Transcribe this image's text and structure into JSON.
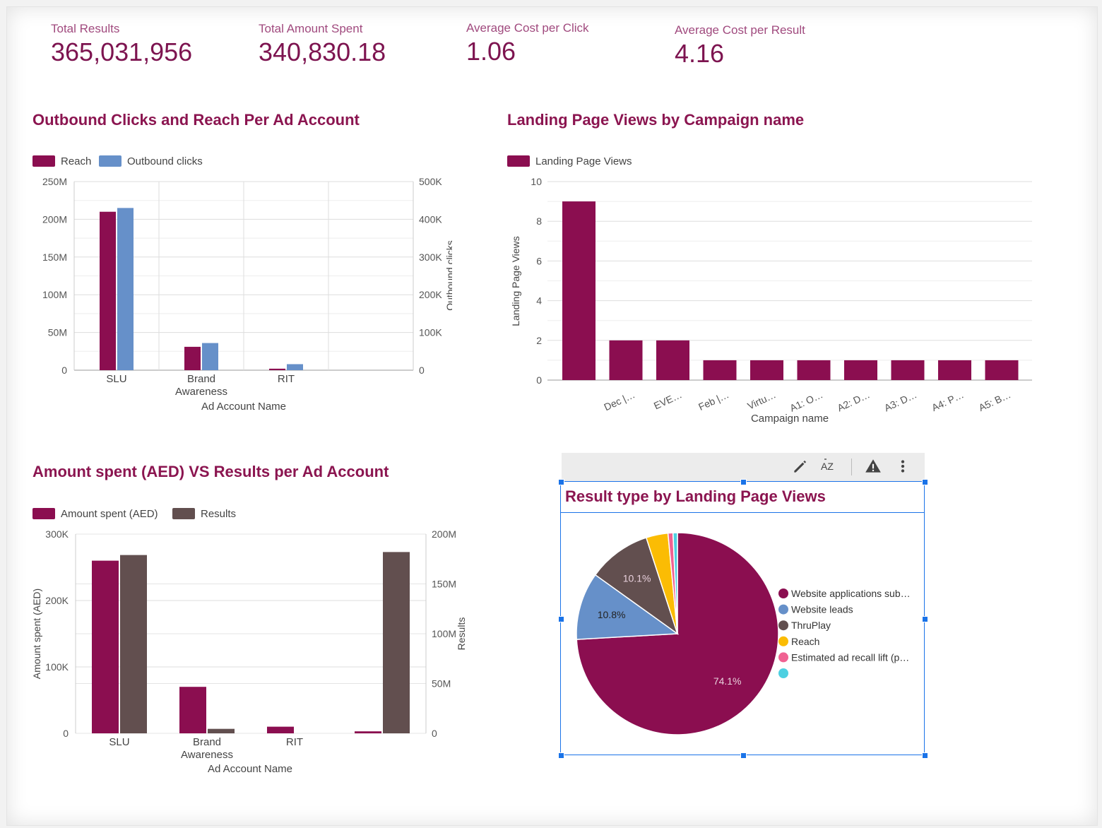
{
  "kpis": [
    {
      "label": "Total Results",
      "value": "365,031,956"
    },
    {
      "label": "Total Amount Spent",
      "value": "340,830.18"
    },
    {
      "label": "Average Cost per Click",
      "value": "1.06"
    },
    {
      "label": "Average Cost per Result",
      "value": "4.16"
    }
  ],
  "colors": {
    "brand": "#8b0e50",
    "blue": "#6690c9",
    "brown": "#624f4f",
    "accent": "#1a73e8"
  },
  "toolbar": {
    "icons": [
      "pencil-icon",
      "sort-az-icon",
      "warning-icon",
      "more-vert-icon"
    ],
    "sort_label": "AZ"
  },
  "chart_data": [
    {
      "type": "bar",
      "title": "Outbound Clicks and Reach Per Ad Account",
      "xlabel": "Ad Account Name",
      "ylabel": "",
      "y2label": "Outbound clicks",
      "categories": [
        "SLU",
        "Brand Awareness",
        "RIT",
        ""
      ],
      "series": [
        {
          "name": "Reach",
          "axis": "left",
          "color": "#8b0e50",
          "values": [
            210000000,
            31000000,
            2000000,
            0
          ]
        },
        {
          "name": "Outbound clicks",
          "axis": "right",
          "color": "#6690c9",
          "values": [
            430000,
            72000,
            16000,
            0
          ]
        }
      ],
      "ylim": [
        0,
        250000000
      ],
      "y2lim": [
        0,
        500000
      ],
      "yticks": [
        "0",
        "50M",
        "100M",
        "150M",
        "200M",
        "250M"
      ],
      "y2ticks": [
        "0",
        "100K",
        "200K",
        "300K",
        "400K",
        "500K"
      ],
      "legend": "top-left",
      "grid": true
    },
    {
      "type": "bar",
      "title": "Landing Page Views by Campaign name",
      "xlabel": "Campaign name",
      "ylabel": "Landing Page Views",
      "categories": [
        "",
        "Dec |…",
        "EVE…",
        "Feb |…",
        "Virtu…",
        "A1: O…",
        "A2: D…",
        "A3: D…",
        "A4: P…",
        "A5: B…"
      ],
      "series": [
        {
          "name": "Landing Page Views",
          "color": "#8b0e50",
          "values": [
            9,
            2,
            2,
            1,
            1,
            1,
            1,
            1,
            1,
            1
          ]
        }
      ],
      "ylim": [
        0,
        10
      ],
      "yticks": [
        "0",
        "2",
        "4",
        "6",
        "8",
        "10"
      ],
      "legend": "top-left",
      "grid": true
    },
    {
      "type": "bar",
      "title": "Amount spent (AED) VS Results per Ad Account",
      "xlabel": "Ad Account Name",
      "ylabel": "Amount spent (AED)",
      "y2label": "Results",
      "categories": [
        "SLU",
        "Brand Awareness",
        "RIT",
        ""
      ],
      "series": [
        {
          "name": "Amount spent (AED)",
          "axis": "left",
          "color": "#8b0e50",
          "values": [
            260000,
            70000,
            10000,
            3000
          ]
        },
        {
          "name": "Results",
          "axis": "right",
          "color": "#624f4f",
          "values": [
            179000000,
            4500000,
            0,
            182000000
          ]
        }
      ],
      "ylim": [
        0,
        300000
      ],
      "y2lim": [
        0,
        200000000
      ],
      "yticks": [
        "0",
        "100K",
        "200K",
        "300K"
      ],
      "y2ticks": [
        "0",
        "50M",
        "100M",
        "150M",
        "200M"
      ],
      "legend": "top-left",
      "grid": true
    },
    {
      "type": "pie",
      "title": "Result type by Landing Page Views",
      "slices": [
        {
          "label": "Website applications sub…",
          "value": 74.1,
          "color": "#8b0e50",
          "text": "74.1%"
        },
        {
          "label": "Website leads",
          "value": 10.8,
          "color": "#6690c9",
          "text": "10.8%"
        },
        {
          "label": "ThruPlay",
          "value": 10.1,
          "color": "#624f4f",
          "text": "10.1%"
        },
        {
          "label": "Reach",
          "value": 3.5,
          "color": "#fbbc04",
          "text": ""
        },
        {
          "label": "Estimated ad recall lift (p…",
          "value": 0.8,
          "color": "#f06292",
          "text": ""
        },
        {
          "label": "",
          "value": 0.7,
          "color": "#4dd0e1",
          "text": ""
        }
      ],
      "legend": "right"
    }
  ]
}
